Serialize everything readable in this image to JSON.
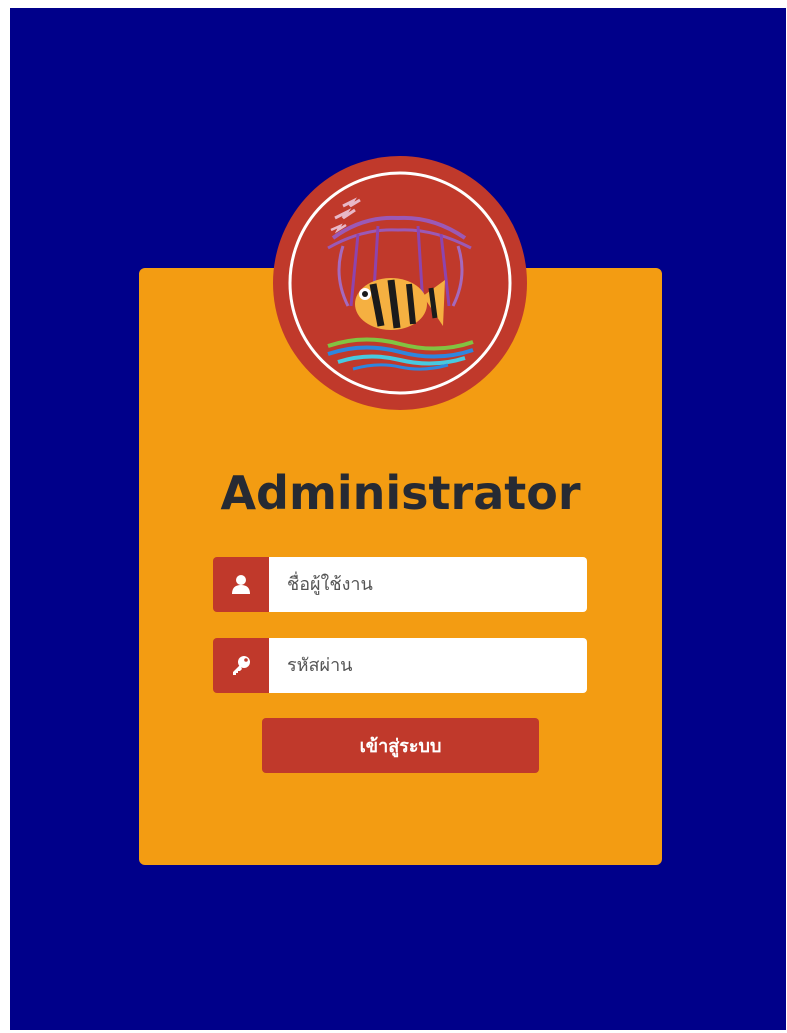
{
  "page": {
    "title": "Administrator"
  },
  "login_form": {
    "username_placeholder": "ชื่อผู้ใช้งาน",
    "password_placeholder": "รหัสผ่าน",
    "submit_label": "เข้าสู่ระบบ"
  },
  "icons": {
    "username": "user-icon",
    "password": "key-icon",
    "logo": "fish-emblem-logo"
  },
  "colors": {
    "background": "#00008a",
    "card": "#f39c12",
    "accent": "#c0392b",
    "title_text": "#262a33"
  }
}
